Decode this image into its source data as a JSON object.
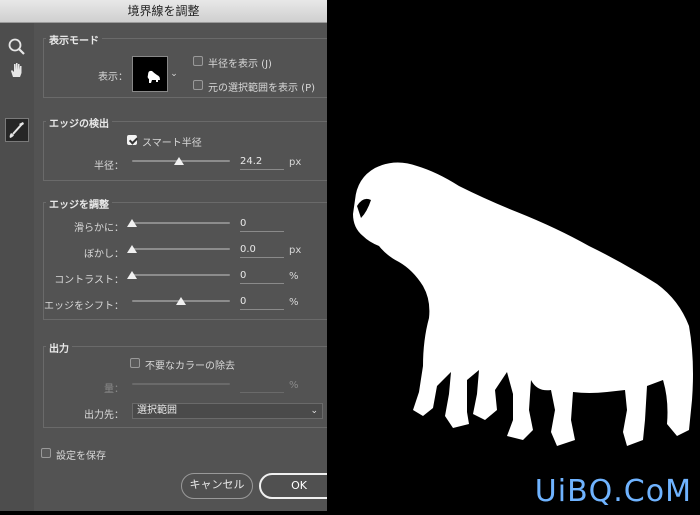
{
  "window": {
    "title": "境界線を調整"
  },
  "tools": [
    {
      "name": "zoom-icon",
      "glyph": "🔍"
    },
    {
      "name": "hand-icon",
      "glyph": "✋"
    },
    {
      "name": "brush-icon",
      "glyph": "🖌"
    }
  ],
  "view_mode": {
    "title": "表示モード",
    "view_label": "表示：",
    "show_radius_label": "半径を表示 (J)",
    "show_radius_checked": false,
    "show_original_label": "元の選択範囲を表示 (P)",
    "show_original_checked": false
  },
  "edge_detection": {
    "title": "エッジの検出",
    "smart_radius_label": "スマート半径",
    "smart_radius_checked": true,
    "radius_label": "半径：",
    "radius_value": "24.2",
    "radius_unit": "px",
    "radius_slider_fraction": 0.48
  },
  "adjust_edge": {
    "title": "エッジを調整",
    "smooth": {
      "label": "滑らかに：",
      "value": "0",
      "unit": "",
      "fraction": 0.0
    },
    "feather": {
      "label": "ぼかし：",
      "value": "0.0",
      "unit": "px",
      "fraction": 0.0
    },
    "contrast": {
      "label": "コントラスト：",
      "value": "0",
      "unit": "%",
      "fraction": 0.0
    },
    "shift_edge": {
      "label": "エッジをシフト：",
      "value": "0",
      "unit": "%",
      "fraction": 0.5
    }
  },
  "output": {
    "title": "出力",
    "decontaminate_label": "不要なカラーの除去",
    "decontaminate_checked": false,
    "amount_label": "量：",
    "amount_value": "",
    "amount_unit": "%",
    "output_to_label": "出力先：",
    "output_to_value": "選択範囲"
  },
  "footer": {
    "remember_label": "設定を保存",
    "remember_checked": false,
    "cancel_label": "キャンセル",
    "ok_label": "OK"
  },
  "watermark": {
    "text": "UiBQ.CoM",
    "color": "#6fb3ff"
  },
  "colors": {
    "panel": "#535353",
    "preview_bg": "#000000",
    "mask": "#ffffff"
  }
}
